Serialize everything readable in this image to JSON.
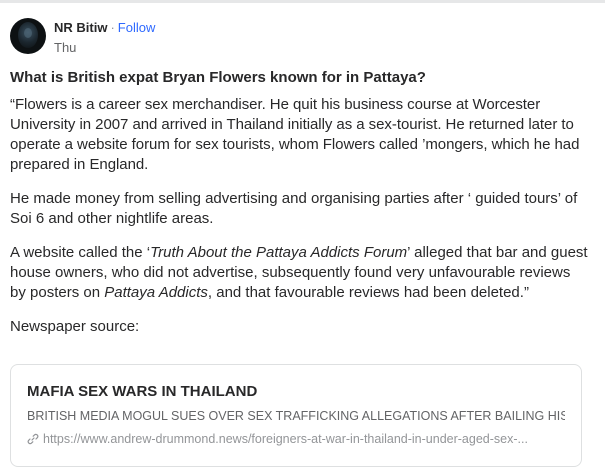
{
  "author": {
    "name": "NR Bitiw",
    "separator": "·",
    "follow_label": "Follow",
    "date": "Thu"
  },
  "post": {
    "question": "What is British expat Bryan Flowers known for in Pattaya?",
    "paragraphs": [
      "“Flowers is a career sex merchandiser. He quit his business course at Worcester University in 2007 and arrived in Thailand initially as a sex-tourist. He returned later to operate a website forum for sex tourists, whom Flowers called ’mongers, which he had prepared in England.",
      "He made money from selling advertising and organising parties after ‘ guided tours’ of Soi 6 and other nightlife areas.",
      "A website called the ‘Truth About the Pattaya Addicts Forum’ alleged that bar and guest house owners, who did not advertise, subsequently found very unfavourable reviews by posters on Pattaya Addicts, and that favourable reviews had been deleted.”",
      "Newspaper source:"
    ],
    "italic_phrases": {
      "site_name": "Truth About the Pattaya Addicts Forum",
      "forum_name": "Pattaya Addicts"
    }
  },
  "link_card": {
    "title": "MAFIA SEX WARS IN THAILAND",
    "subtitle": "BRITISH MEDIA MOGUL SUES OVER SEX TRAFFICKING ALLEGATIONS AFTER BAILING HIS...",
    "url": "https://www.andrew-drummond.news/foreigners-at-war-in-thailand-in-under-aged-sex-...",
    "icon": "link-icon"
  },
  "colors": {
    "text": "#282829",
    "muted": "#636466",
    "link_blue": "#2e69ff",
    "border": "#dee0e1"
  }
}
